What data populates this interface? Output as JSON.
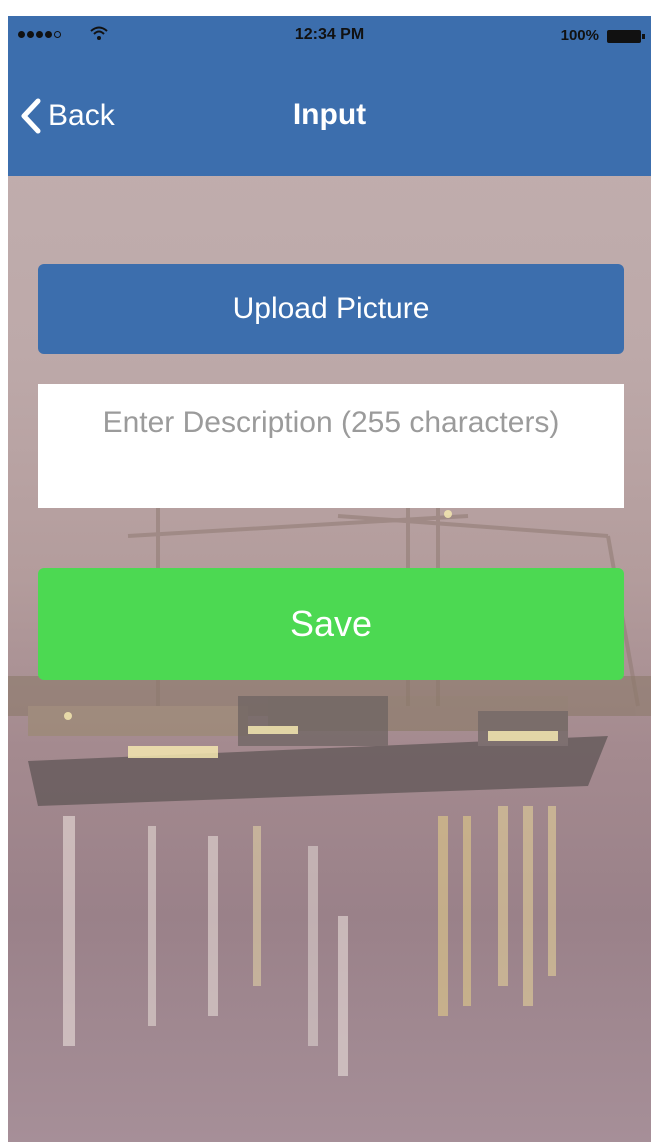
{
  "status_bar": {
    "time": "12:34 PM",
    "battery": "100%",
    "signal_icon": "signal-dots-icon",
    "wifi_icon": "wifi-icon",
    "battery_icon": "battery-icon"
  },
  "nav": {
    "back_label": "Back",
    "back_icon": "chevron-left-icon",
    "title": "Input"
  },
  "form": {
    "upload_label": "Upload Picture",
    "description_value": "",
    "description_placeholder": "Enter Description (255 characters)",
    "save_label": "Save"
  },
  "colors": {
    "bar": "#3c6ead",
    "upload_button": "#3c6ead",
    "save_button": "#4cd952",
    "input_bg": "#ffffff"
  }
}
